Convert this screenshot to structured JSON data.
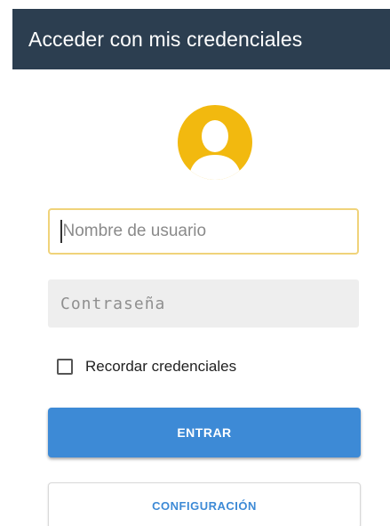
{
  "app_bar": {
    "title": "Acceder con mis credenciales"
  },
  "avatar": {
    "icon": "user-avatar-icon",
    "color": "#f2b90f"
  },
  "form": {
    "username": {
      "placeholder": "Nombre de usuario",
      "value": ""
    },
    "password": {
      "placeholder": "Contraseña",
      "value": ""
    },
    "remember": {
      "label": "Recordar credenciales",
      "checked": false
    }
  },
  "buttons": {
    "enter_label": "ENTRAR",
    "config_label": "CONFIGURACIÓN"
  },
  "colors": {
    "app_bar": "#2c3e50",
    "primary": "#3d8ad6",
    "focus_border": "#f0d37a"
  }
}
